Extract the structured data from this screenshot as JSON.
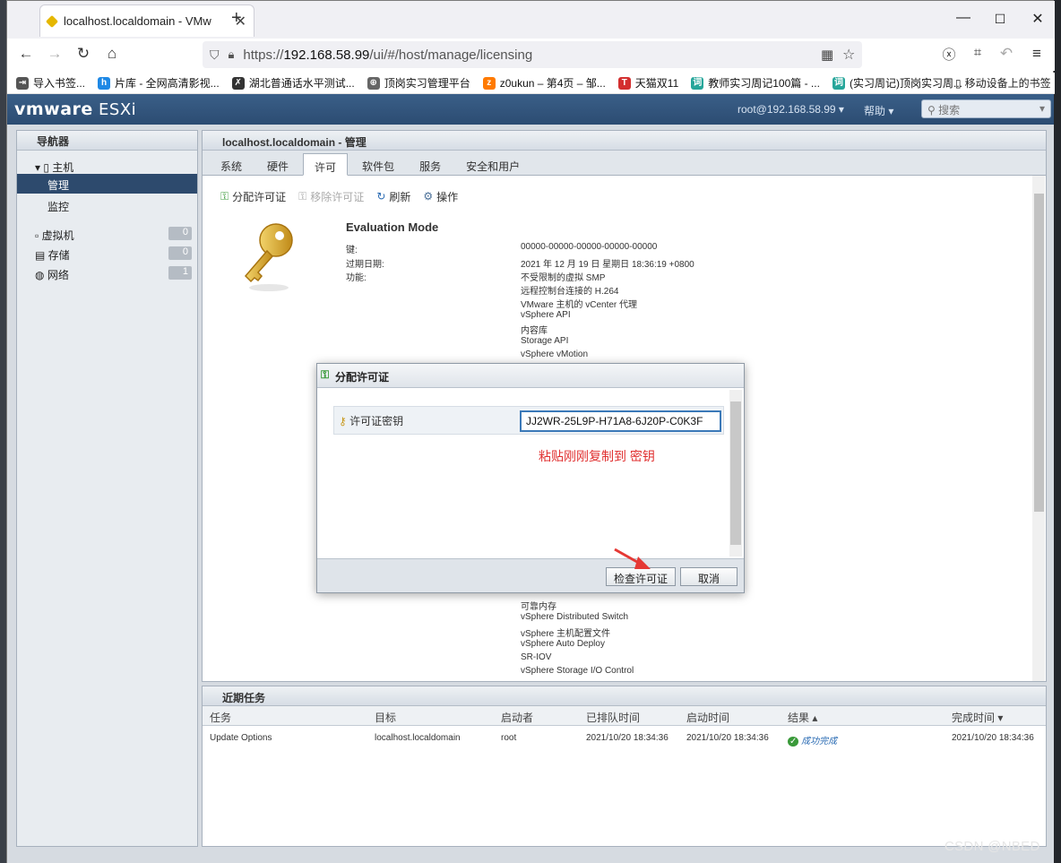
{
  "browser": {
    "tab_title": "localhost.localdomain - VMw",
    "url_prefix": "https://",
    "url_host": "192.168.58.99",
    "url_path": "/ui/#/host/manage/licensing",
    "bookmarks": [
      {
        "label": "导入书签...",
        "color": "#555555",
        "glyph": "⇥"
      },
      {
        "label": "片库 - 全网高清影视...",
        "color": "#1e88e5",
        "glyph": "h"
      },
      {
        "label": "湖北普通话水平测试...",
        "color": "#333333",
        "glyph": "✗"
      },
      {
        "label": "顶岗实习管理平台",
        "color": "#666666",
        "glyph": "⊕"
      },
      {
        "label": "z0ukun – 第4页 – 邹...",
        "color": "#ff7a00",
        "glyph": "z"
      },
      {
        "label": "天猫双11",
        "color": "#d32f2f",
        "glyph": "T"
      },
      {
        "label": "教师实习周记100篇 - ...",
        "color": "#26a69a",
        "glyph": "词"
      },
      {
        "label": "(实习周记)顶岗实习周...",
        "color": "#26a69a",
        "glyph": "词"
      }
    ],
    "mobile_bookmarks": "移动设备上的书签"
  },
  "esxi": {
    "logo_vm": "vmware",
    "logo_esxi": " ESXi",
    "user": "root@192.168.58.99 ▾",
    "help": "帮助 ▾",
    "search_placeholder": "搜索",
    "navigator": {
      "title": "导航器",
      "host": "主机",
      "items": [
        {
          "label": "管理",
          "selected": true
        },
        {
          "label": "监控",
          "selected": false
        }
      ],
      "groups": [
        {
          "label": "虚拟机",
          "count": "0"
        },
        {
          "label": "存储",
          "count": "0"
        },
        {
          "label": "网络",
          "count": "1"
        }
      ]
    },
    "main": {
      "title": "localhost.localdomain - 管理",
      "tabs": [
        "系统",
        "硬件",
        "许可",
        "软件包",
        "服务",
        "安全和用户"
      ],
      "active_tab": "许可",
      "toolbar": {
        "assign": "分配许可证",
        "remove": "移除许可证",
        "refresh": "刷新",
        "actions": "操作"
      },
      "license": {
        "title": "Evaluation Mode",
        "key_label": "键:",
        "key_value": "00000-00000-00000-00000-00000",
        "expiry_label": "过期日期:",
        "expiry_value": "2021 年 12 月 19 日 星期日 18:36:19 +0800",
        "features_label": "功能:",
        "features_top": [
          "不受限制的虚拟 SMP",
          "远程控制台连接的 H.264",
          "VMware 主机的 vCenter 代理",
          "vSphere API",
          "内容库",
          "Storage API",
          "vSphere vMotion"
        ],
        "features_bottom": [
          "可靠内存",
          "vSphere Distributed Switch",
          "vSphere 主机配置文件",
          "vSphere Auto Deploy",
          "SR-IOV",
          "vSphere Storage I/O Control"
        ]
      }
    },
    "tasks": {
      "title": "近期任务",
      "columns": [
        "任务",
        "目标",
        "启动者",
        "已排队时间",
        "启动时间",
        "结果 ▴",
        "完成时间 ▾"
      ],
      "rows": [
        {
          "task": "Update Options",
          "target": "localhost.localdomain",
          "initiator": "root",
          "queued": "2021/10/20 18:34:36",
          "started": "2021/10/20 18:34:36",
          "result": "成功完成",
          "completed": "2021/10/20 18:34:36"
        }
      ]
    },
    "modal": {
      "title": "分配许可证",
      "field_label": "许可证密钥",
      "field_value": "JJ2WR-25L9P-H71A8-6J20P-C0K3F",
      "note": "粘贴刚刚复制到 密钥",
      "check_button": "检查许可证",
      "cancel_button": "取消"
    }
  },
  "watermark": "CSDN @NBED",
  "colors": {
    "accent": "#2d4a6d",
    "header": "#2c4c72",
    "note": "#e03030",
    "input_border": "#3b79b8"
  }
}
